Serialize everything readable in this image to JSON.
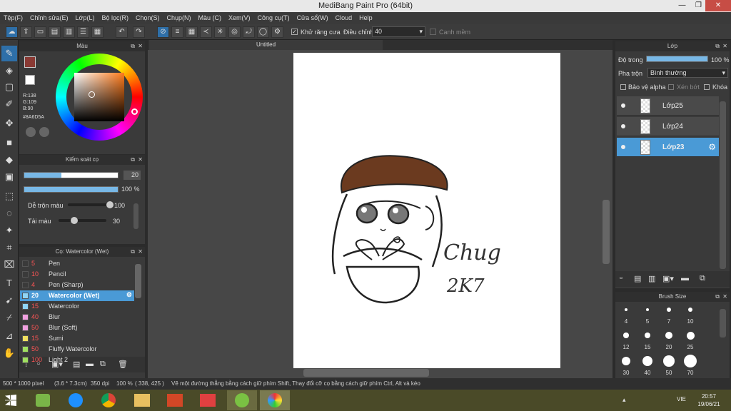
{
  "window": {
    "title": "MediBang Paint Pro (64bit)"
  },
  "menu": [
    "Tệp(F)",
    "Chỉnh sửa(E)",
    "Lớp(L)",
    "Bộ lọc(R)",
    "Chọn(S)",
    "Chụp(N)",
    "Màu (C)",
    "Xem(V)",
    "Công cụ(T)",
    "Cửa sổ(W)",
    "Cloud",
    "Help"
  ],
  "toolbar": {
    "antialias_label": "Khử răng cưa",
    "adjust_label": "Điều chỉnh",
    "adjust_value": "40",
    "edge_label": "Canh mềm"
  },
  "color_panel": {
    "title": "Màu",
    "r": "R:138",
    "g": "G:109",
    "b": "B:90",
    "hex": "#8A6D5A",
    "fg_color": "#8a3a34"
  },
  "brush_control": {
    "title": "Kiểm soát cọ",
    "size_value": "20",
    "size_fill": 0.4,
    "opacity_value": "100 %",
    "opacity_fill": 1.0,
    "blend_label": "Dễ trộn màu",
    "blend_value": "100",
    "blend_fill": 1.0,
    "amount_label": "Tải màu",
    "amount_value": "30",
    "amount_fill": 0.3
  },
  "brush_panel": {
    "title": "Cọ: Watercolor (Wet)",
    "items": [
      {
        "size": "5",
        "name": "Pen",
        "color": "#3a3a3a"
      },
      {
        "size": "10",
        "name": "Pencil",
        "color": "#3a3a3a"
      },
      {
        "size": "4",
        "name": "Pen (Sharp)",
        "color": "#3a3a3a"
      },
      {
        "size": "20",
        "name": "Watercolor (Wet)",
        "color": "#8fd4f5",
        "selected": true
      },
      {
        "size": "15",
        "name": "Watercolor",
        "color": "#8fd4f5"
      },
      {
        "size": "40",
        "name": "Blur",
        "color": "#f0a0e0"
      },
      {
        "size": "50",
        "name": "Blur (Soft)",
        "color": "#f0a0e0"
      },
      {
        "size": "15",
        "name": "Sumi",
        "color": "#f0e060"
      },
      {
        "size": "50",
        "name": "Fluffy Watercolor",
        "color": "#a0e060"
      },
      {
        "size": "100",
        "name": "Light 2",
        "color": "#a0e060"
      }
    ]
  },
  "canvas": {
    "tab_title": "Untitled",
    "signature_line1": "Chug",
    "signature_line2": "2K7"
  },
  "layer_panel": {
    "title": "Lớp",
    "opacity_label": "Độ trong",
    "opacity_value": "100 %",
    "opacity_fill": 1.0,
    "blend_label": "Pha trộn",
    "blend_value": "Bình thường",
    "protect_alpha": "Bảo vệ alpha",
    "clip": "Xén bớt",
    "lock": "Khóa",
    "layers": [
      {
        "name": "Lớp25"
      },
      {
        "name": "Lớp24"
      },
      {
        "name": "Lớp23",
        "selected": true
      }
    ]
  },
  "brush_size_panel": {
    "title": "Brush Size",
    "sizes": [
      "4",
      "5",
      "7",
      "10",
      "12",
      "15",
      "20",
      "25",
      "30",
      "40",
      "50",
      "70"
    ]
  },
  "status": {
    "size": "500 * 1000 pixel",
    "cm": "(3.6 * 7.3cm)",
    "dpi": "350 dpi",
    "zoom": "100 %",
    "coords": "( 338, 425 )",
    "hint": "Vẽ một đường thẳng bằng cách giữ phím Shift, Thay đổi cỡ cọ bằng cách giữ phím Ctrl, Alt và kéo"
  },
  "taskbar": {
    "time": "20:57",
    "date": "19/06/21",
    "lang": "VIE"
  }
}
